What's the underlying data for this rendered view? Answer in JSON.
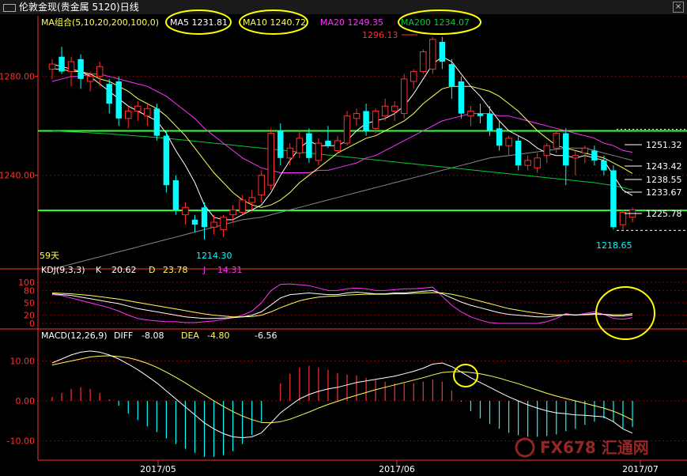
{
  "window": {
    "title": "伦敦金现(贵金属 5120)日线"
  },
  "colors": {
    "bg": "#000000",
    "grid": "#8b0000",
    "up": "#ff3030",
    "down": "#00ffff",
    "ma5": "#ffffff",
    "ma10": "#ffff55",
    "ma20": "#ff33ff",
    "ma200": "#00cc33",
    "hline": "#33ff33",
    "axis": "#ff3030",
    "kdj_k": "#ffffff",
    "kdj_d": "#ffff55",
    "kdj_j": "#ff33ff",
    "circle": "#ffff00"
  },
  "main": {
    "legend": {
      "label": "MA组合(5,10,20,200,100,0)",
      "ma5": "MA5 1231.81",
      "ma10": "MA10 1240.72",
      "ma20": "MA20 1249.35",
      "ma200": "MA200 1234.07"
    },
    "y_ticks": [
      "1280.00",
      "1240.00"
    ],
    "annotations": {
      "high": "1296.13",
      "low1": "1214.30",
      "low2": "1218.65",
      "days": "59天"
    },
    "price_labels": [
      "1251.32",
      "1243.42",
      "1238.55",
      "1233.67",
      "1225.78"
    ]
  },
  "kdj": {
    "label": "KDJ(9,3,3)",
    "k_label": "K",
    "k_val": "20.62",
    "d_label": "D",
    "d_val": "23.78",
    "j_label": "J",
    "j_val": "14.31",
    "y_ticks": [
      "100",
      "80",
      "50",
      "20",
      "0"
    ]
  },
  "macd": {
    "label": "MACD(12,26,9)",
    "diff_label": "DIFF",
    "diff_val": "-8.08",
    "dea_label": "DEA",
    "dea_val": "-4.80",
    "macd_val": "-6.56",
    "y_ticks": [
      "10.00",
      "0.00",
      "-10.00"
    ]
  },
  "x_ticks": [
    "2017/05",
    "2017/06",
    "2017/07"
  ],
  "watermark": "FX678 汇通网",
  "chart_data": {
    "type": "candlestick",
    "title": "伦敦金现(贵金属 5120)日线",
    "ylim": [
      1205,
      1302
    ],
    "candles": [
      {
        "o": 1283,
        "h": 1287,
        "l": 1279,
        "c": 1285
      },
      {
        "o": 1288,
        "h": 1292,
        "l": 1281,
        "c": 1282
      },
      {
        "o": 1282,
        "h": 1288,
        "l": 1276,
        "c": 1286
      },
      {
        "o": 1287,
        "h": 1289,
        "l": 1275,
        "c": 1279
      },
      {
        "o": 1278,
        "h": 1282,
        "l": 1274,
        "c": 1280
      },
      {
        "o": 1280,
        "h": 1286,
        "l": 1276,
        "c": 1284
      },
      {
        "o": 1277,
        "h": 1279,
        "l": 1265,
        "c": 1269
      },
      {
        "o": 1278,
        "h": 1280,
        "l": 1260,
        "c": 1263
      },
      {
        "o": 1263,
        "h": 1268,
        "l": 1259,
        "c": 1266
      },
      {
        "o": 1266,
        "h": 1270,
        "l": 1262,
        "c": 1268
      },
      {
        "o": 1264,
        "h": 1269,
        "l": 1260,
        "c": 1267
      },
      {
        "o": 1267,
        "h": 1269,
        "l": 1254,
        "c": 1256
      },
      {
        "o": 1256,
        "h": 1258,
        "l": 1233,
        "c": 1236
      },
      {
        "o": 1238,
        "h": 1240,
        "l": 1224,
        "c": 1226
      },
      {
        "o": 1224,
        "h": 1229,
        "l": 1220,
        "c": 1227
      },
      {
        "o": 1222,
        "h": 1224,
        "l": 1217,
        "c": 1220
      },
      {
        "o": 1227,
        "h": 1229,
        "l": 1214,
        "c": 1219
      },
      {
        "o": 1219,
        "h": 1224,
        "l": 1216,
        "c": 1221
      },
      {
        "o": 1218,
        "h": 1224,
        "l": 1215,
        "c": 1223
      },
      {
        "o": 1224,
        "h": 1228,
        "l": 1221,
        "c": 1226
      },
      {
        "o": 1225,
        "h": 1232,
        "l": 1224,
        "c": 1230
      },
      {
        "o": 1229,
        "h": 1234,
        "l": 1225,
        "c": 1231
      },
      {
        "o": 1232,
        "h": 1242,
        "l": 1229,
        "c": 1240
      },
      {
        "o": 1236,
        "h": 1259,
        "l": 1234,
        "c": 1257
      },
      {
        "o": 1258,
        "h": 1261,
        "l": 1244,
        "c": 1247
      },
      {
        "o": 1247,
        "h": 1253,
        "l": 1244,
        "c": 1251
      },
      {
        "o": 1249,
        "h": 1258,
        "l": 1247,
        "c": 1255
      },
      {
        "o": 1257,
        "h": 1259,
        "l": 1245,
        "c": 1247
      },
      {
        "o": 1246,
        "h": 1255,
        "l": 1244,
        "c": 1253
      },
      {
        "o": 1254,
        "h": 1260,
        "l": 1251,
        "c": 1252
      },
      {
        "o": 1250,
        "h": 1256,
        "l": 1249,
        "c": 1254
      },
      {
        "o": 1253,
        "h": 1266,
        "l": 1252,
        "c": 1264
      },
      {
        "o": 1263,
        "h": 1267,
        "l": 1260,
        "c": 1265
      },
      {
        "o": 1266,
        "h": 1269,
        "l": 1256,
        "c": 1258
      },
      {
        "o": 1259,
        "h": 1267,
        "l": 1257,
        "c": 1266
      },
      {
        "o": 1264,
        "h": 1271,
        "l": 1262,
        "c": 1268
      },
      {
        "o": 1266,
        "h": 1270,
        "l": 1262,
        "c": 1268
      },
      {
        "o": 1265,
        "h": 1281,
        "l": 1263,
        "c": 1279
      },
      {
        "o": 1278,
        "h": 1283,
        "l": 1275,
        "c": 1282
      },
      {
        "o": 1282,
        "h": 1291,
        "l": 1281,
        "c": 1290
      },
      {
        "o": 1283,
        "h": 1296,
        "l": 1281,
        "c": 1295
      },
      {
        "o": 1294,
        "h": 1296,
        "l": 1283,
        "c": 1286
      },
      {
        "o": 1285,
        "h": 1287,
        "l": 1271,
        "c": 1276
      },
      {
        "o": 1278,
        "h": 1280,
        "l": 1263,
        "c": 1265
      },
      {
        "o": 1264,
        "h": 1268,
        "l": 1260,
        "c": 1266
      },
      {
        "o": 1265,
        "h": 1269,
        "l": 1261,
        "c": 1264
      },
      {
        "o": 1265,
        "h": 1268,
        "l": 1256,
        "c": 1258
      },
      {
        "o": 1259,
        "h": 1262,
        "l": 1250,
        "c": 1252
      },
      {
        "o": 1252,
        "h": 1256,
        "l": 1248,
        "c": 1255
      },
      {
        "o": 1254,
        "h": 1256,
        "l": 1242,
        "c": 1244
      },
      {
        "o": 1244,
        "h": 1248,
        "l": 1242,
        "c": 1246
      },
      {
        "o": 1243,
        "h": 1249,
        "l": 1241,
        "c": 1247
      },
      {
        "o": 1248,
        "h": 1253,
        "l": 1245,
        "c": 1252
      },
      {
        "o": 1251,
        "h": 1258,
        "l": 1249,
        "c": 1257
      },
      {
        "o": 1257,
        "h": 1259,
        "l": 1236,
        "c": 1244
      },
      {
        "o": 1247,
        "h": 1250,
        "l": 1240,
        "c": 1248
      },
      {
        "o": 1249,
        "h": 1252,
        "l": 1245,
        "c": 1251
      },
      {
        "o": 1250,
        "h": 1252,
        "l": 1244,
        "c": 1246
      },
      {
        "o": 1246,
        "h": 1248,
        "l": 1240,
        "c": 1242
      },
      {
        "o": 1242,
        "h": 1244,
        "l": 1218,
        "c": 1219
      },
      {
        "o": 1220,
        "h": 1226,
        "l": 1218,
        "c": 1225
      },
      {
        "o": 1223,
        "h": 1227,
        "l": 1221,
        "c": 1226
      }
    ],
    "ma5": [
      1285,
      1284,
      1283,
      1282,
      1280,
      1277,
      1274,
      1271,
      1268,
      1266,
      1264,
      1262,
      1257,
      1250,
      1244,
      1237,
      1228,
      1223,
      1222,
      1222,
      1224,
      1226,
      1228,
      1233,
      1240,
      1246,
      1251,
      1254,
      1252,
      1252,
      1252,
      1254,
      1258,
      1261,
      1262,
      1263,
      1265,
      1268,
      1273,
      1279,
      1285,
      1288,
      1286,
      1281,
      1276,
      1272,
      1267,
      1262,
      1258,
      1256,
      1254,
      1251,
      1249,
      1248,
      1248,
      1247,
      1248,
      1247,
      1246,
      1240,
      1234,
      1231.81
    ],
    "ma10": [
      1283,
      1283,
      1282,
      1282,
      1281,
      1279,
      1278,
      1276,
      1274,
      1271,
      1269,
      1267,
      1264,
      1260,
      1256,
      1251,
      1246,
      1241,
      1237,
      1233,
      1230,
      1228,
      1227,
      1228,
      1230,
      1233,
      1237,
      1240,
      1243,
      1246,
      1249,
      1251,
      1253,
      1255,
      1256,
      1258,
      1260,
      1262,
      1265,
      1269,
      1272,
      1275,
      1276,
      1276,
      1276,
      1275,
      1274,
      1272,
      1269,
      1266,
      1262,
      1258,
      1255,
      1252,
      1251,
      1250,
      1249,
      1248,
      1247,
      1245,
      1243,
      1240.72
    ],
    "ma20": [
      1278,
      1279,
      1280,
      1280,
      1281,
      1281,
      1280,
      1279,
      1278,
      1277,
      1276,
      1274,
      1272,
      1269,
      1266,
      1263,
      1259,
      1256,
      1253,
      1250,
      1247,
      1245,
      1243,
      1242,
      1241,
      1241,
      1241,
      1241,
      1242,
      1242,
      1243,
      1244,
      1245,
      1247,
      1248,
      1250,
      1252,
      1254,
      1256,
      1258,
      1260,
      1262,
      1263,
      1264,
      1265,
      1265,
      1265,
      1264,
      1264,
      1263,
      1262,
      1261,
      1260,
      1259,
      1258,
      1257,
      1256,
      1255,
      1253,
      1252,
      1250,
      1249.35
    ],
    "ma200": [
      1258,
      1257.8,
      1257.6,
      1257.4,
      1257.2,
      1257,
      1256.8,
      1256.5,
      1256.2,
      1255.9,
      1255.6,
      1255.3,
      1255,
      1254.6,
      1254.2,
      1253.8,
      1253.4,
      1253,
      1252.6,
      1252.2,
      1251.8,
      1251.4,
      1251,
      1250.6,
      1250.2,
      1249.8,
      1249.4,
      1249,
      1248.6,
      1248.2,
      1247.8,
      1247.4,
      1247,
      1246.6,
      1246.2,
      1245.8,
      1245.4,
      1245,
      1244.6,
      1244.2,
      1243.8,
      1243.4,
      1243,
      1242.6,
      1242.2,
      1241.8,
      1241.4,
      1241,
      1240.6,
      1240.2,
      1239.8,
      1239.4,
      1239,
      1238.6,
      1238.2,
      1237.8,
      1237.4,
      1237,
      1236.4,
      1235.8,
      1235,
      1234.07
    ],
    "ma100": [
      1202,
      1203,
      1204,
      1205,
      1206,
      1207,
      1208,
      1209,
      1210,
      1211,
      1212,
      1213,
      1214,
      1215,
      1216,
      1217,
      1218,
      1219,
      1220,
      1221,
      1222,
      1222.5,
      1223,
      1224,
      1225,
      1226,
      1227,
      1228,
      1229,
      1230,
      1231,
      1232,
      1233,
      1234,
      1235,
      1236,
      1237,
      1238,
      1239,
      1240,
      1241,
      1242,
      1243,
      1244,
      1245,
      1246,
      1247,
      1247.5,
      1248,
      1248.5,
      1249,
      1249.5,
      1250,
      1250.5,
      1251,
      1251,
      1251,
      1250,
      1249,
      1248,
      1247,
      1246
    ],
    "hlines": [
      1258,
      1225.78
    ],
    "kdj": {
      "k": [
        72,
        70,
        68,
        64,
        60,
        56,
        52,
        48,
        42,
        36,
        32,
        28,
        24,
        20,
        16,
        14,
        12,
        12,
        13,
        14,
        16,
        20,
        28,
        45,
        62,
        70,
        72,
        74,
        72,
        70,
        70,
        74,
        76,
        74,
        72,
        72,
        74,
        74,
        76,
        78,
        80,
        72,
        62,
        52,
        44,
        38,
        32,
        26,
        22,
        20,
        18,
        16,
        16,
        18,
        22,
        20,
        22,
        24,
        22,
        18,
        18,
        20.62
      ],
      "d": [
        74,
        73,
        72,
        70,
        68,
        65,
        62,
        59,
        55,
        51,
        47,
        43,
        39,
        35,
        31,
        27,
        23,
        20,
        18,
        16,
        16,
        17,
        20,
        28,
        38,
        47,
        55,
        60,
        64,
        66,
        67,
        69,
        70,
        71,
        71,
        71,
        72,
        72,
        73,
        74,
        75,
        74,
        71,
        66,
        60,
        54,
        48,
        42,
        36,
        32,
        28,
        25,
        22,
        21,
        21,
        21,
        21,
        22,
        22,
        21,
        21,
        23.78
      ],
      "j": [
        70,
        68,
        62,
        56,
        50,
        44,
        38,
        30,
        20,
        12,
        8,
        6,
        4,
        4,
        2,
        2,
        4,
        6,
        10,
        14,
        20,
        30,
        50,
        80,
        95,
        96,
        94,
        92,
        86,
        80,
        80,
        84,
        86,
        84,
        80,
        80,
        82,
        84,
        84,
        86,
        88,
        66,
        44,
        28,
        16,
        8,
        2,
        0,
        0,
        0,
        0,
        0,
        4,
        12,
        24,
        20,
        24,
        28,
        22,
        12,
        10,
        14.31
      ]
    },
    "macd": {
      "diff": [
        9.5,
        10.5,
        11.5,
        12.2,
        12.5,
        12.2,
        11.5,
        10.5,
        9.2,
        7.8,
        6.2,
        4.5,
        2.5,
        0.5,
        -1.5,
        -3.5,
        -5.5,
        -7,
        -8.2,
        -9,
        -9.2,
        -9,
        -8,
        -5.5,
        -3,
        -1.2,
        0.5,
        1.6,
        2.4,
        3,
        3.4,
        4,
        4.6,
        5,
        5.4,
        5.8,
        6.2,
        6.8,
        7.4,
        8.2,
        9.2,
        9.5,
        8.6,
        7.2,
        5.8,
        4.6,
        3.4,
        2.2,
        1,
        0,
        -1,
        -1.8,
        -2.5,
        -3,
        -3.2,
        -3.5,
        -3.6,
        -3.8,
        -4,
        -5.2,
        -7,
        -8.08
      ],
      "dea": [
        9,
        9.5,
        10,
        10.5,
        11,
        11.2,
        11.3,
        11.1,
        10.8,
        10.2,
        9.4,
        8.4,
        7.2,
        5.9,
        4.5,
        3,
        1.5,
        0,
        -1.4,
        -2.7,
        -3.8,
        -4.7,
        -5.4,
        -5.5,
        -5.2,
        -4.6,
        -3.7,
        -2.8,
        -1.8,
        -0.9,
        -0.1,
        0.7,
        1.4,
        2.1,
        2.8,
        3.4,
        4,
        4.6,
        5.2,
        5.8,
        6.5,
        7.1,
        7.3,
        7.3,
        7.1,
        6.8,
        6.3,
        5.7,
        5,
        4.3,
        3.5,
        2.7,
        1.9,
        1.2,
        0.6,
        0,
        -0.6,
        -1.2,
        -1.8,
        -2.6,
        -3.6,
        -4.8
      ]
    }
  }
}
